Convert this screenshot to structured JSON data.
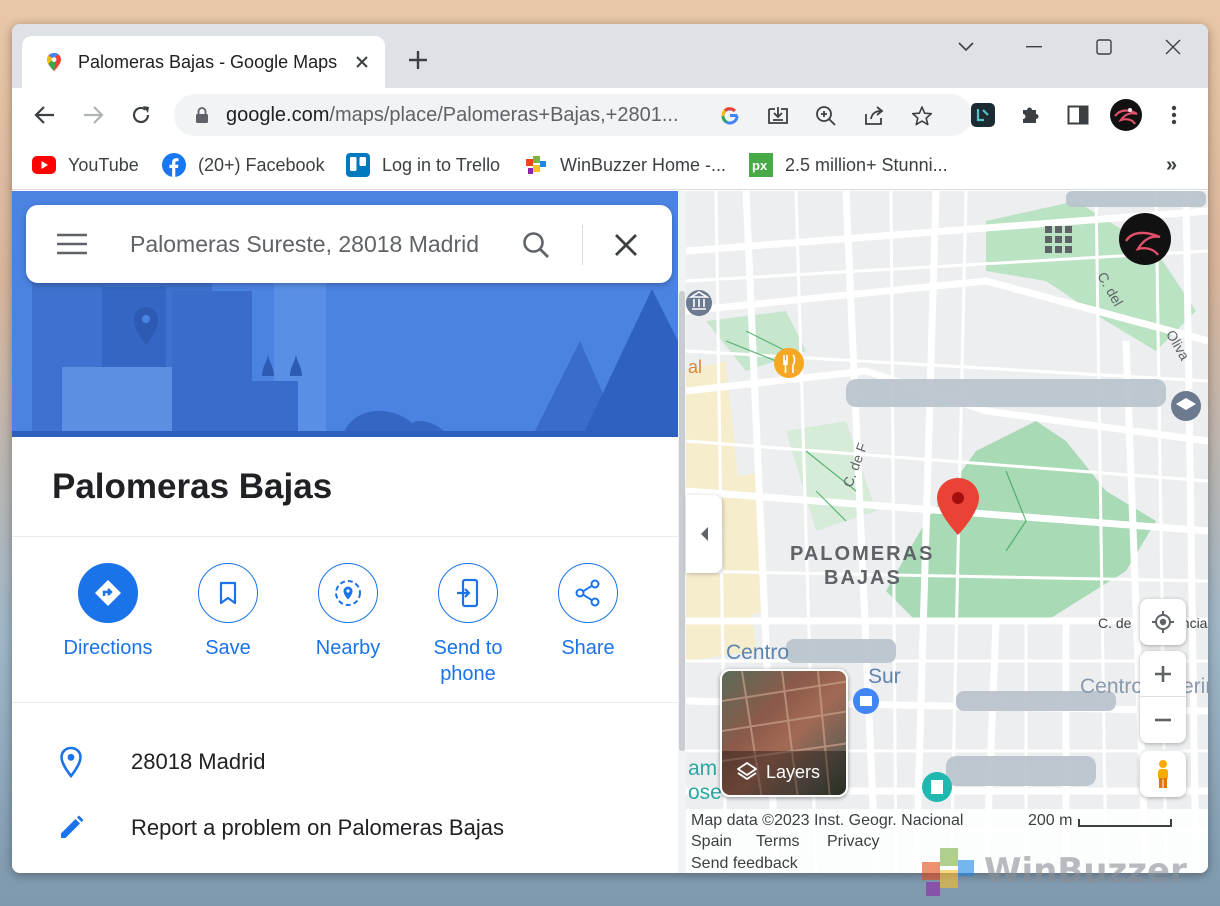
{
  "browser": {
    "tab_title": "Palomeras Bajas - Google Maps",
    "url_domain": "google.com",
    "url_path": "/maps/place/Palomeras+Bajas,+2801..."
  },
  "bookmarks": [
    {
      "label": "YouTube",
      "icon": "youtube-icon"
    },
    {
      "label": "(20+) Facebook",
      "icon": "facebook-icon"
    },
    {
      "label": "Log in to Trello",
      "icon": "trello-icon"
    },
    {
      "label": "WinBuzzer Home -...",
      "icon": "winbuzzer-icon"
    },
    {
      "label": "2.5 million+ Stunni...",
      "icon": "pixabay-icon"
    }
  ],
  "search": {
    "value": "Palomeras Sureste, 28018 Madrid"
  },
  "place": {
    "title": "Palomeras Bajas"
  },
  "actions": [
    {
      "label": "Directions"
    },
    {
      "label": "Save"
    },
    {
      "label": "Nearby"
    },
    {
      "label": "Send to phone"
    },
    {
      "label": "Share"
    }
  ],
  "info": {
    "address": "28018 Madrid",
    "report": "Report a problem on Palomeras Bajas"
  },
  "map": {
    "area_label_1": "PALOMERAS",
    "area_label_2": "BAJAS",
    "street_1": "C. de F",
    "street_2": "C. del",
    "street_3": "C. de",
    "street_4": "encia",
    "street_5": "Oliva",
    "centro": "Centro",
    "sur": "Sur",
    "centro_2": "Centro",
    "centro_2b": "erin",
    "frag_1": "al",
    "frag_2": "am",
    "frag_3": "ose",
    "layers_label": "Layers",
    "footer_data": "Map data ©2023 Inst. Geogr. Nacional",
    "scale": "200 m",
    "footer_spain": "Spain",
    "footer_terms": "Terms",
    "footer_privacy": "Privacy",
    "footer_feedback": "Send feedback"
  },
  "watermark": {
    "text": "WinBuzzer"
  },
  "colors": {
    "accent": "#1a73e8",
    "pin": "#ea4335",
    "park": "#a8dab5",
    "hero": "#4a7fe0"
  }
}
